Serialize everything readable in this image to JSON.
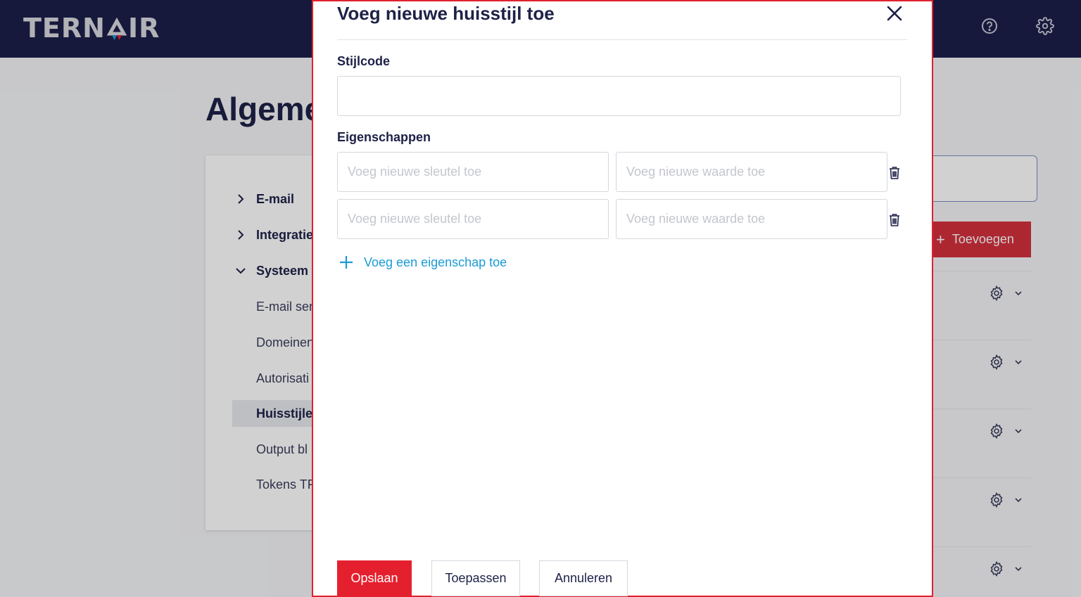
{
  "header": {
    "logo_text_left": "TERN",
    "logo_text_right": "IR",
    "help_icon": "help-circle-icon",
    "settings_icon": "gear-icon"
  },
  "page": {
    "title_visible": "Algeme"
  },
  "sidebar": {
    "items": [
      {
        "label": "E-mail"
      },
      {
        "label": "Integratie"
      },
      {
        "label": "Systeem"
      },
      {
        "label": "E-mail ser"
      },
      {
        "label": "Domeinen"
      },
      {
        "label": "Autorisati"
      },
      {
        "label": "Huisstijle"
      },
      {
        "label": "Output bl"
      },
      {
        "label": "Tokens TF"
      }
    ]
  },
  "background": {
    "add_button_label": "Toevoegen"
  },
  "modal": {
    "title": "Voeg nieuwe huisstijl toe",
    "stijlcode_label": "Stijlcode",
    "stijlcode_value": "",
    "eigenschappen_label": "Eigenschappen",
    "properties": [
      {
        "key_placeholder": "Voeg nieuwe sleutel toe",
        "value_placeholder": "Voeg nieuwe waarde toe"
      },
      {
        "key_placeholder": "Voeg nieuwe sleutel toe",
        "value_placeholder": "Voeg nieuwe waarde toe"
      }
    ],
    "add_property_label": "Voeg een eigenschap toe",
    "save_label": "Opslaan",
    "apply_label": "Toepassen",
    "cancel_label": "Annuleren"
  },
  "colors": {
    "navy": "#1c1f4a",
    "red": "#e5202e",
    "link_blue": "#1a9bd6"
  }
}
